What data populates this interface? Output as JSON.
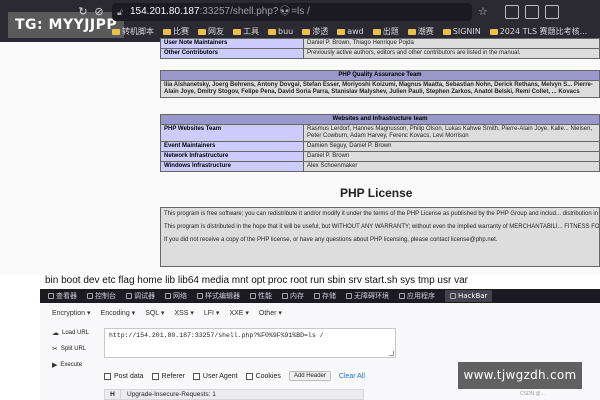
{
  "watermark_top": "TG: MYYJJPP",
  "watermark_bottom": "www.tjwgzdh.com",
  "browser": {
    "url_host": "154.201.80.187",
    "url_rest": ":33257/shell.php?",
    "url_suffix": "=ls /",
    "bookmarks": [
      "转机脚本",
      "比赛",
      "网友",
      "工具",
      "buu",
      "渗透",
      "awd",
      "出题",
      "潮赛",
      "SIGNIN",
      "2024 TLS 赛题比考核..."
    ]
  },
  "php_info": {
    "credits_rows_top": [
      {
        "label": "User Note Maintainers",
        "value": "Daniel P. Brown, Thiago Henrique Pojda"
      },
      {
        "label": "Other Contributors",
        "value": "Previously active authors, editors and other contributors are listed in the manual."
      }
    ],
    "qa_header": "PHP Quality Assurance Team",
    "qa_text": "Ilia Alshanetsky, Joerg Behrens, Antony Dovgal, Stefan Esser, Moriyoshi Koizumi, Magnus Maatta, Sebastian Nohn, Derick Rethans, Melvyn S... Pierre-Alain Joye, Dmitry Stogov, Felipe Pena, David Soria Parra, Stanislav Malyshev, Julien Pauli, Stephen Zarkos, Anatol Belski, Remi Collet, ... Kovacs",
    "infra_header": "Websites and Infrastructure team",
    "infra_rows": [
      {
        "label": "PHP Websites Team",
        "value": "Rasmus Lerdorf, Hannes Magnusson, Philip Olson, Lukas Kahwe Smith, Pierre-Alain Joye, Kalle... Nielsen, Peter Cowburn, Adam Harvey, Ferenc Kovacs, Levi Morrison"
      },
      {
        "label": "Event Maintainers",
        "value": "Damien Seguy, Daniel P. Brown"
      },
      {
        "label": "Network Infrastructure",
        "value": "Daniel P. Brown"
      },
      {
        "label": "Windows Infrastructure",
        "value": "Alex Schoenmaker"
      }
    ],
    "license_title": "PHP License",
    "license_paragraphs": [
      "This program is free software; you can redistribute it and/or modify it under the terms of the PHP License as published by the PHP Group and includ... distribution in the file: LICENSE",
      "This program is distributed in the hope that it will be useful, but WITHOUT ANY WARRANTY; without even the implied warranty of MERCHANTABILI... FITNESS FOR A PARTICULAR PURPOSE.",
      "If you did not receive a copy of the PHP license, or have any questions about PHP licensing, please contact license@php.net."
    ]
  },
  "command_output": "bin boot dev etc flag home lib lib64 media mnt opt proc root run sbin srv start.sh sys tmp usr var",
  "devtools": {
    "tabs": [
      "查看器",
      "控制台",
      "调试器",
      "网络",
      "样式编辑器",
      "性能",
      "内存",
      "存储",
      "无障碍环境",
      "应用程序"
    ],
    "active_tab": "HackBar"
  },
  "hackbar": {
    "menus": [
      "Encryption ▾",
      "Encoding ▾",
      "SQL ▾",
      "XSS ▾",
      "LFI ▾",
      "XXE ▾",
      "Other ▾"
    ],
    "load_url": "Load URL",
    "split_url": "Split URL",
    "execute": "Execute",
    "url_value": "http://154.201.80.187:33257/shell.php?%F0%9F%91%BD=ls /",
    "checks": [
      "Post data",
      "Referer",
      "User Agent",
      "Cookies"
    ],
    "add_header": "Add Header",
    "clear_all": "Clear All",
    "header_key": "H",
    "header_value": "Upgrade-Insecure-Requests: 1"
  },
  "csdn_tag": "CSDN @..."
}
